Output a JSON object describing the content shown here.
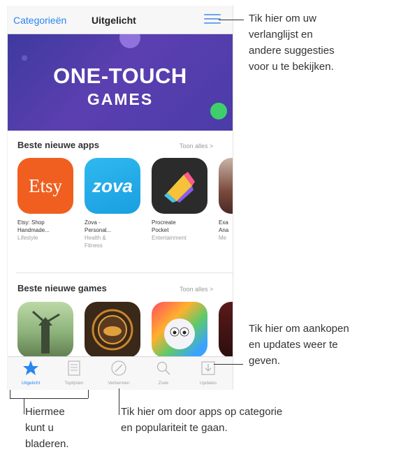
{
  "nav": {
    "categories_label": "Categorieën",
    "featured_label": "Uitgelicht"
  },
  "banner": {
    "line1": "ONE-TOUCH",
    "line2": "GAMES"
  },
  "sections": [
    {
      "title": "Beste nieuwe apps",
      "see_all": "Toon alles >",
      "apps": [
        {
          "name_line1": "Etsy: Shop",
          "name_line2": "Handmade...",
          "category": "Lifestyle",
          "icon_text": "Etsy"
        },
        {
          "name_line1": "Zova -",
          "name_line2": "Personal...",
          "category": "Health &",
          "category2": "Fitness",
          "icon_text": "zova"
        },
        {
          "name_line1": "Procreate",
          "name_line2": "Pocket",
          "category": "Entertainment"
        },
        {
          "name_line1": "Exa",
          "name_line2": "Ana",
          "category": "Me"
        }
      ]
    },
    {
      "title": "Beste nieuwe games",
      "see_all": "Toon alles >"
    }
  ],
  "tabbar": {
    "items": [
      {
        "label": "Uitgelicht",
        "icon": "star-icon",
        "active": true
      },
      {
        "label": "Toplijsten",
        "icon": "list-icon"
      },
      {
        "label": "Verkennen",
        "icon": "compass-icon"
      },
      {
        "label": "Zoek",
        "icon": "search-icon"
      },
      {
        "label": "Updates",
        "icon": "download-icon"
      }
    ]
  },
  "callouts": {
    "wishlist": [
      "Tik hier om uw",
      "verlanglijst en",
      "andere suggesties",
      "voor u te bekijken."
    ],
    "updates": [
      "Tik hier om aankopen",
      "en updates weer te",
      "geven."
    ],
    "browse": [
      "Hiermee",
      "kunt u",
      "bladeren."
    ],
    "categories": [
      "Tik hier om door apps op categorie",
      "en populariteit te gaan."
    ]
  },
  "colors": {
    "accent": "#2a86f0",
    "banner": "#4a3ca8",
    "etsy": "#f05f1f",
    "zova": "#24aeea"
  }
}
